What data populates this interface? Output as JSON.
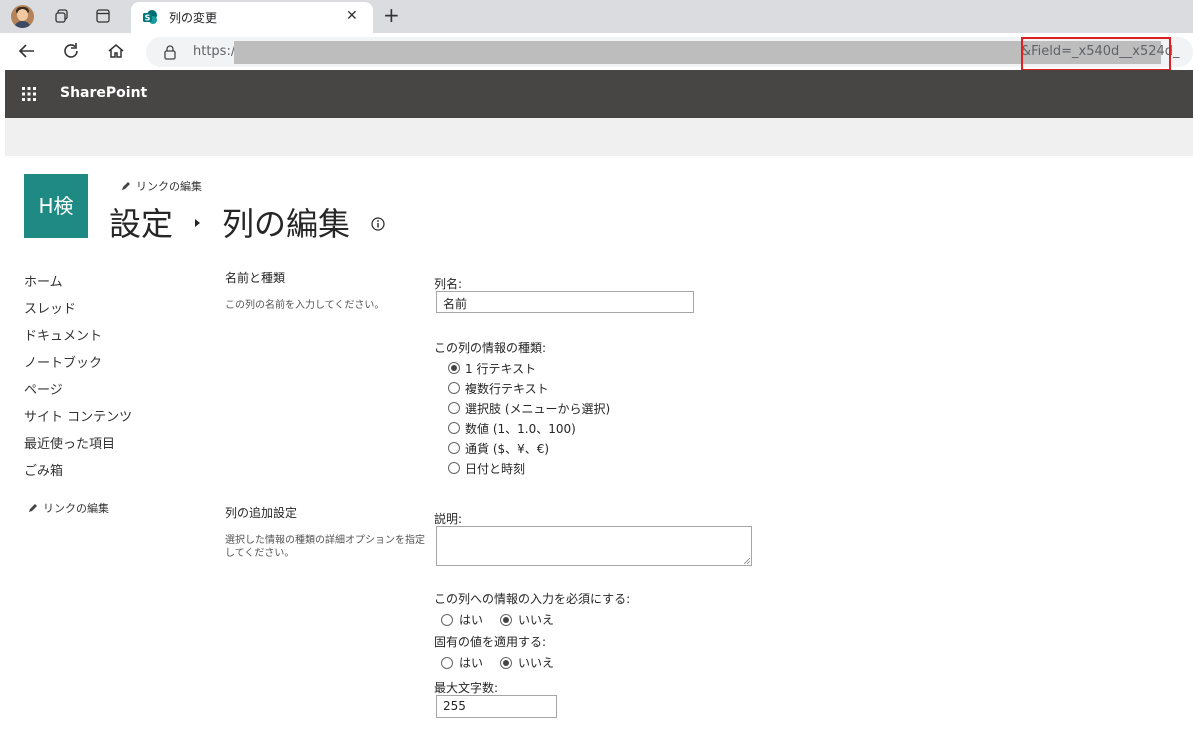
{
  "browser": {
    "tab_title": "列の変更",
    "tab_close": "✕",
    "new_tab": "+",
    "url_scheme": "https://",
    "url_tail": "&Field=_x540d__x524d_"
  },
  "suite": {
    "brand": "SharePoint"
  },
  "site": {
    "logo_text": "H検",
    "edit_links": "リンクの編集",
    "crumb_settings": "設定",
    "crumb_edit_column": "列の編集"
  },
  "leftnav": {
    "items": [
      "ホーム",
      "スレッド",
      "ドキュメント",
      "ノートブック",
      "ページ",
      "サイト コンテンツ",
      "最近使った項目",
      "ごみ箱"
    ],
    "edit_links": "リンクの編集"
  },
  "form": {
    "section1": {
      "title": "名前と種類",
      "desc": "この列の名前を入力してください。"
    },
    "column_name_label": "列名:",
    "column_name_value": "名前",
    "type_label": "この列の情報の種類:",
    "types": [
      {
        "label": "1 行テキスト",
        "selected": true
      },
      {
        "label": "複数行テキスト",
        "selected": false
      },
      {
        "label": "選択肢 (メニューから選択)",
        "selected": false
      },
      {
        "label": "数値 (1、1.0、100)",
        "selected": false
      },
      {
        "label": "通貨 ($、¥、€)",
        "selected": false
      },
      {
        "label": "日付と時刻",
        "selected": false
      }
    ],
    "section2": {
      "title": "列の追加設定",
      "desc": "選択した情報の種類の詳細オプションを指定してください。"
    },
    "description_label": "説明:",
    "description_value": "",
    "required_label": "この列への情報の入力を必須にする:",
    "unique_label": "固有の値を適用する:",
    "yes": "はい",
    "no": "いいえ",
    "required_value": "いいえ",
    "unique_value": "いいえ",
    "max_chars_label": "最大文字数:",
    "max_chars_value": "255"
  }
}
